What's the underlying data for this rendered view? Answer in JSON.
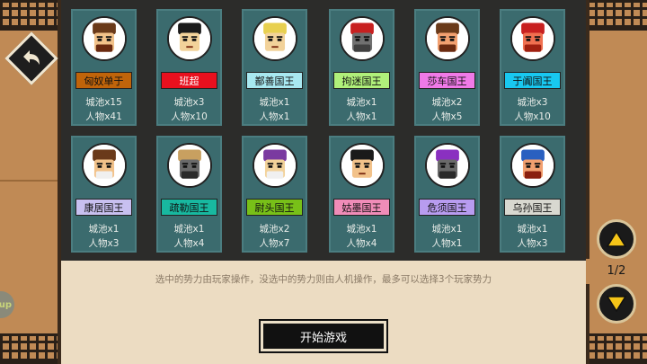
{
  "hint_text": "选中的势力由玩家操作，没选中的势力则由人机操作，最多可以选择3个玩家势力",
  "start_button_label": "开始游戏",
  "page_indicator": "1/2",
  "side_badge_text": "up",
  "factions": [
    {
      "name": "匈奴单于",
      "cities": "城池x15",
      "people": "人物x41",
      "banner_color": "#c0640a",
      "name_color": "#111111"
    },
    {
      "name": "班超",
      "cities": "城池x3",
      "people": "人物x10",
      "banner_color": "#e8101e",
      "name_color": "#ffffff"
    },
    {
      "name": "鄯善国王",
      "cities": "城池x1",
      "people": "人物x1",
      "banner_color": "#a8e8f0",
      "name_color": "#111111"
    },
    {
      "name": "拘迷国王",
      "cities": "城池x1",
      "people": "人物x1",
      "banner_color": "#b0f07a",
      "name_color": "#111111"
    },
    {
      "name": "莎车国王",
      "cities": "城池x2",
      "people": "人物x5",
      "banner_color": "#f07ae8",
      "name_color": "#111111"
    },
    {
      "name": "于阗国王",
      "cities": "城池x3",
      "people": "人物x10",
      "banner_color": "#18c8f0",
      "name_color": "#111111"
    },
    {
      "name": "康居国王",
      "cities": "城池x1",
      "people": "人物x3",
      "banner_color": "#c8c0f0",
      "name_color": "#111111"
    },
    {
      "name": "疏勒国王",
      "cities": "城池x1",
      "people": "人物x4",
      "banner_color": "#18b8a0",
      "name_color": "#111111"
    },
    {
      "name": "尉头国王",
      "cities": "城池x2",
      "people": "人物x7",
      "banner_color": "#78c018",
      "name_color": "#111111"
    },
    {
      "name": "姑墨国王",
      "cities": "城池x1",
      "people": "人物x4",
      "banner_color": "#f08cb8",
      "name_color": "#111111"
    },
    {
      "name": "危须国王",
      "cities": "城池x1",
      "people": "人物x1",
      "banner_color": "#b89cf0",
      "name_color": "#111111"
    },
    {
      "name": "乌孙国王",
      "cities": "城池x1",
      "people": "人物x3",
      "banner_color": "#d8d8d0",
      "name_color": "#111111"
    }
  ],
  "icons": {
    "back": "back-arrow-icon",
    "page_up": "triangle-up-icon",
    "page_down": "triangle-down-icon"
  }
}
